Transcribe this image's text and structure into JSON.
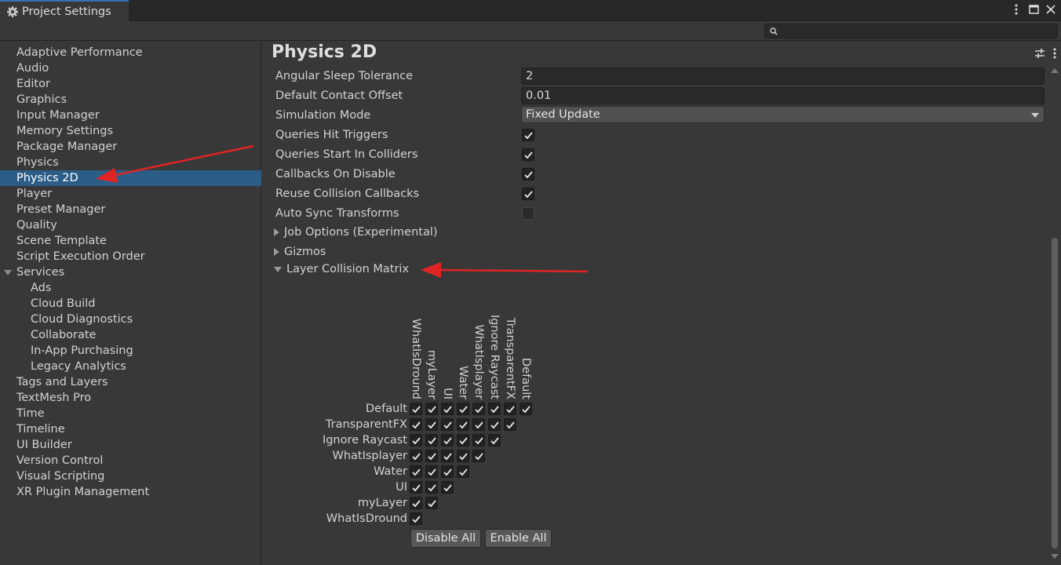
{
  "window": {
    "tab_title": "Project Settings",
    "icons": [
      "kebab-menu-icon",
      "maximize-icon",
      "close-icon"
    ]
  },
  "search": {
    "placeholder": "",
    "value": ""
  },
  "sidebar": {
    "items": [
      {
        "label": "Adaptive Performance"
      },
      {
        "label": "Audio"
      },
      {
        "label": "Editor"
      },
      {
        "label": "Graphics"
      },
      {
        "label": "Input Manager"
      },
      {
        "label": "Memory Settings"
      },
      {
        "label": "Package Manager"
      },
      {
        "label": "Physics"
      },
      {
        "label": "Physics 2D",
        "selected": true
      },
      {
        "label": "Player"
      },
      {
        "label": "Preset Manager"
      },
      {
        "label": "Quality"
      },
      {
        "label": "Scene Template"
      },
      {
        "label": "Script Execution Order"
      },
      {
        "label": "Services",
        "expanded": true
      },
      {
        "label": "Ads",
        "indent": 1
      },
      {
        "label": "Cloud Build",
        "indent": 1
      },
      {
        "label": "Cloud Diagnostics",
        "indent": 1
      },
      {
        "label": "Collaborate",
        "indent": 1
      },
      {
        "label": "In-App Purchasing",
        "indent": 1
      },
      {
        "label": "Legacy Analytics",
        "indent": 1
      },
      {
        "label": "Tags and Layers"
      },
      {
        "label": "TextMesh Pro"
      },
      {
        "label": "Time"
      },
      {
        "label": "Timeline"
      },
      {
        "label": "UI Builder"
      },
      {
        "label": "Version Control"
      },
      {
        "label": "Visual Scripting"
      },
      {
        "label": "XR Plugin Management"
      }
    ]
  },
  "main": {
    "title": "Physics 2D",
    "header_icons": [
      "preset-sliders-icon",
      "kebab-menu-icon"
    ],
    "fields": [
      {
        "label": "Angular Sleep Tolerance",
        "type": "text",
        "value": "2"
      },
      {
        "label": "Default Contact Offset",
        "type": "text",
        "value": "0.01"
      },
      {
        "label": "Simulation Mode",
        "type": "dropdown",
        "value": "Fixed Update"
      },
      {
        "label": "Queries Hit Triggers",
        "type": "checkbox",
        "checked": true
      },
      {
        "label": "Queries Start In Colliders",
        "type": "checkbox",
        "checked": true
      },
      {
        "label": "Callbacks On Disable",
        "type": "checkbox",
        "checked": true
      },
      {
        "label": "Reuse Collision Callbacks",
        "type": "checkbox",
        "checked": true
      },
      {
        "label": "Auto Sync Transforms",
        "type": "checkbox",
        "checked": false
      }
    ],
    "foldouts": [
      {
        "label": "Job Options (Experimental)",
        "expanded": false
      },
      {
        "label": "Gizmos",
        "expanded": false
      },
      {
        "label": "Layer Collision Matrix",
        "expanded": true
      }
    ],
    "matrix": {
      "layers": [
        "Default",
        "TransparentFX",
        "Ignore Raycast",
        "WhatIsplayer",
        "Water",
        "UI",
        "myLayer",
        "WhatIsDround"
      ],
      "column_labels": [
        "WhatIsDround",
        "myLayer",
        "UI",
        "Water",
        "WhatIsplayer",
        "Ignore Raycast",
        "TransparentFX",
        "Default"
      ],
      "all_checked": true,
      "disable_all_label": "Disable All",
      "enable_all_label": "Enable All"
    }
  },
  "colors": {
    "selection": "#2c5d87",
    "annotation_arrow": "#e02424",
    "panel_bg": "#383838"
  }
}
